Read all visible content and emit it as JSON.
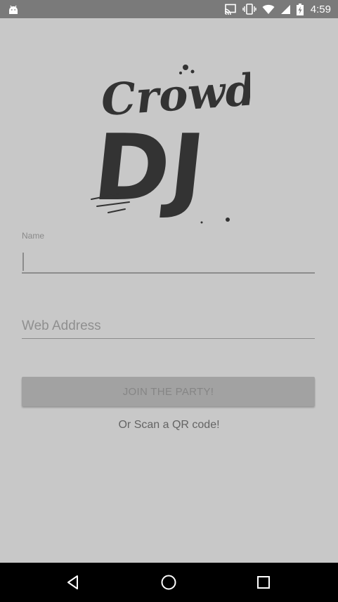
{
  "status_bar": {
    "time": "4:59",
    "icons": [
      "android-icon",
      "cast-icon",
      "vibrate-icon",
      "wifi-icon",
      "cell-signal-icon",
      "battery-charging-icon"
    ]
  },
  "logo": {
    "line1": "Crowd",
    "line2": "DJ"
  },
  "form": {
    "name_label": "Name",
    "name_value": "",
    "web_placeholder": "Web Address",
    "web_value": "",
    "join_label": "JOIN THE PARTY!",
    "qr_label": "Or Scan a QR code!"
  },
  "nav_bar": {
    "icons": [
      "back-icon",
      "home-icon",
      "recents-icon"
    ]
  },
  "colors": {
    "background": "#c8c8c8",
    "status_bar": "#7a7a7a",
    "button": "#a2a2a2",
    "nav_bar": "#000000"
  }
}
